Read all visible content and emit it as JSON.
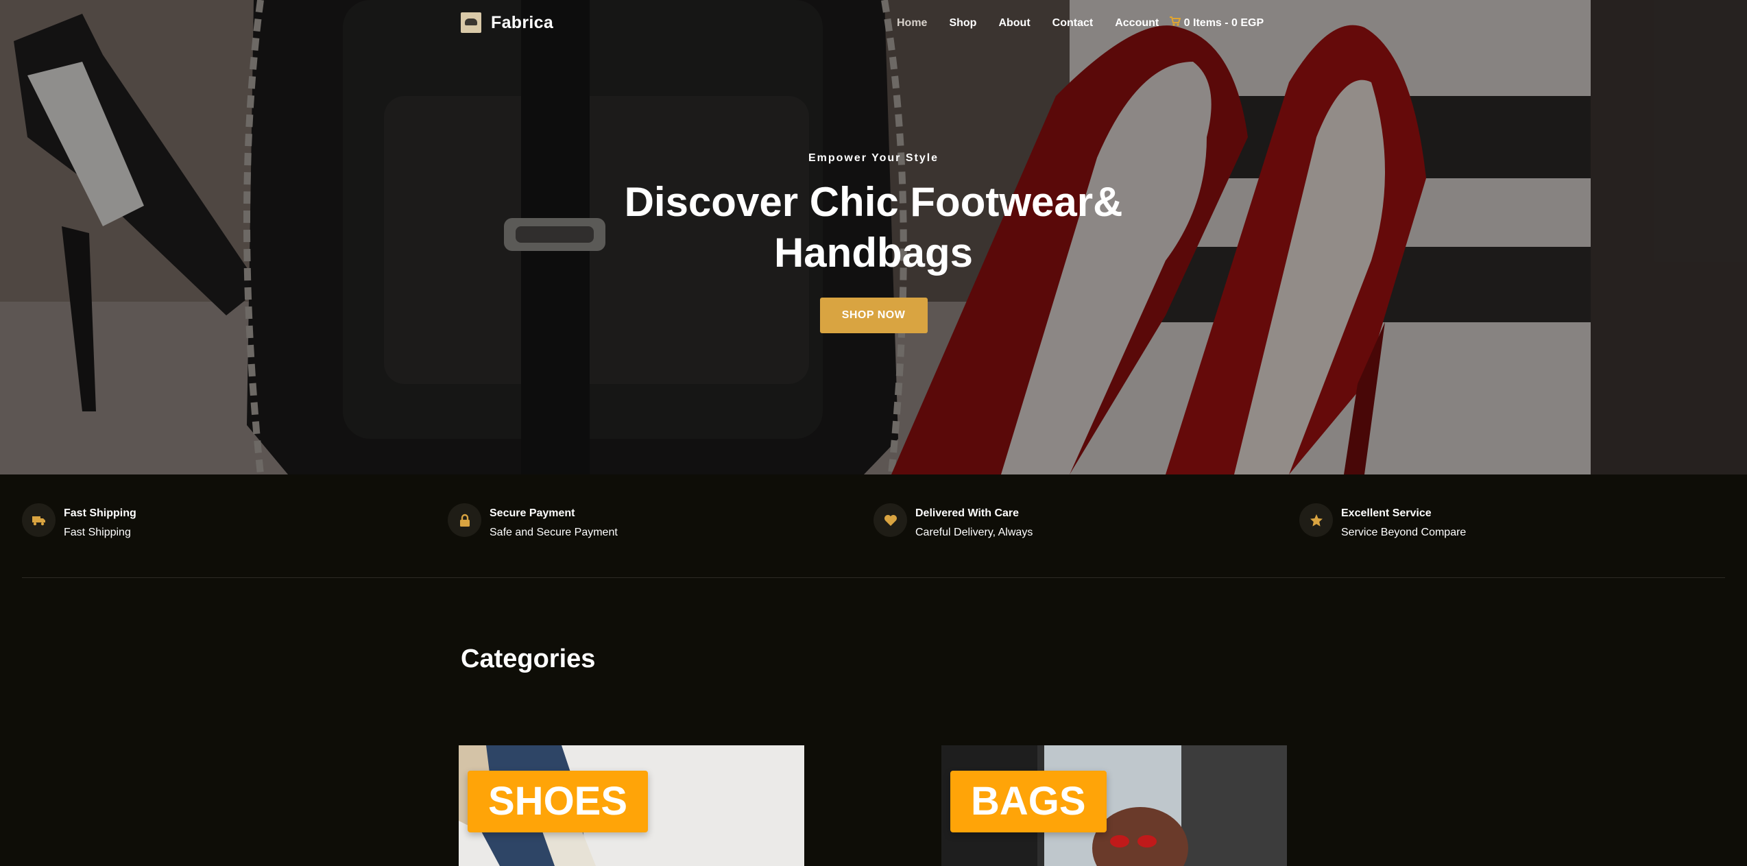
{
  "colors": {
    "accent": "#d9a441",
    "cart": "#e0a530",
    "category_label_bg": "#ffa408",
    "page_bg": "#0e0d07"
  },
  "nav": {
    "brand": "Fabrica",
    "logo_icon": "brand-logo-icon",
    "items": [
      "Home",
      "Shop",
      "About",
      "Contact",
      "Account"
    ],
    "active": "Home",
    "cart_icon": "shopping-cart-icon",
    "cart_text": "0 Items - 0 EGP"
  },
  "hero": {
    "eyebrow": "Empower Your Style",
    "headline_line1": "Discover Chic Footwear&",
    "headline_line2": "Handbags",
    "cta": "SHOP NOW"
  },
  "features": [
    {
      "icon": "truck-icon",
      "title": "Fast Shipping",
      "subtitle": "Fast Shipping"
    },
    {
      "icon": "lock-icon",
      "title": "Secure Payment",
      "subtitle": "Safe and Secure Payment"
    },
    {
      "icon": "heart-icon",
      "title": "Delivered With Care",
      "subtitle": "Careful Delivery, Always"
    },
    {
      "icon": "star-icon",
      "title": "Excellent Service",
      "subtitle": "Service Beyond Compare"
    }
  ],
  "categories": {
    "title": "Categories",
    "items": [
      {
        "label": "SHOES"
      },
      {
        "label": "BAGS"
      }
    ]
  }
}
